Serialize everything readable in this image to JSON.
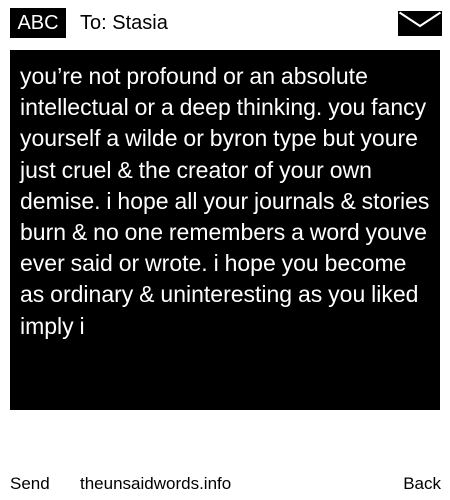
{
  "header": {
    "badge": "ABC",
    "recipient": "To: Stasia",
    "icon": "envelope-icon"
  },
  "message": {
    "text": "you’re not profound or an absolute intellectual or a deep thinking. you fancy yourself a wilde or byron type but youre just cruel & the creator of your own demise. i hope all your journals & stories burn & no one remembers a word youve ever said or wrote. i hope you become as ordinary & uninteresting as you liked imply i"
  },
  "footer": {
    "send_label": "Send",
    "site_label": "theunsaidwords.info",
    "back_label": "Back"
  },
  "colors": {
    "background": "#ffffff",
    "message_background": "#000000",
    "message_text": "#ffffff"
  }
}
